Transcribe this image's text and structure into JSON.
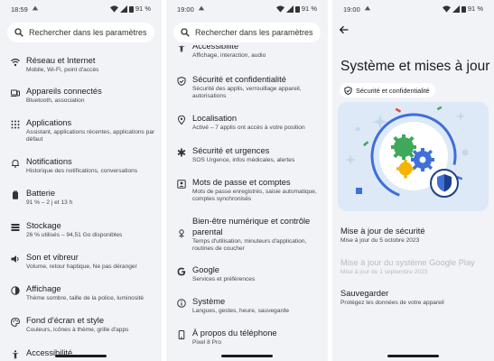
{
  "status_bars": [
    {
      "time": "18:59",
      "battery": "91 %"
    },
    {
      "time": "19:00",
      "battery": "91 %"
    },
    {
      "time": "19:00",
      "battery": "91 %"
    }
  ],
  "search": {
    "label": "Rechercher dans les paramètres"
  },
  "panel1": {
    "items": [
      {
        "icon": "wifi-icon",
        "title": "Réseau et Internet",
        "subtitle": "Mobile, Wi‑Fi, point d'accès"
      },
      {
        "icon": "devices-icon",
        "title": "Appareils connectés",
        "subtitle": "Bluetooth, association"
      },
      {
        "icon": "apps-grid-icon",
        "title": "Applications",
        "subtitle": "Assistant, applications récentes, applications par défaut"
      },
      {
        "icon": "bell-icon",
        "title": "Notifications",
        "subtitle": "Historique des notifications, conversations"
      },
      {
        "icon": "battery-icon",
        "title": "Batterie",
        "subtitle": "91 % – 2 j et 13 h"
      },
      {
        "icon": "storage-icon",
        "title": "Stockage",
        "subtitle": "26 % utilisés – 94,51 Go disponibles"
      },
      {
        "icon": "volume-icon",
        "title": "Son et vibreur",
        "subtitle": "Volume, retour haptique, Ne pas déranger"
      },
      {
        "icon": "brightness-icon",
        "title": "Affichage",
        "subtitle": "Thème sombre, taille de la police, luminosité"
      },
      {
        "icon": "palette-icon",
        "title": "Fond d'écran et style",
        "subtitle": "Couleurs, icônes à thème, grille d'apps"
      },
      {
        "icon": "accessibility-icon",
        "title": "Accessibilité",
        "subtitle": ""
      }
    ]
  },
  "panel2": {
    "items": [
      {
        "icon": "accessibility-icon",
        "title": "Accessibilité",
        "subtitle": "Affichage, interaction, audio"
      },
      {
        "icon": "shield-icon",
        "title": "Sécurité et confidentialité",
        "subtitle": "Sécurité des applis, verrouillage appareil, autorisations"
      },
      {
        "icon": "location-pin-icon",
        "title": "Localisation",
        "subtitle": "Activé – 7 applis ont accès à votre position"
      },
      {
        "icon": "emergency-icon",
        "title": "Sécurité et urgences",
        "subtitle": "SOS Urgence, infos médicales, alertes"
      },
      {
        "icon": "key-icon",
        "title": "Mots de passe et comptes",
        "subtitle": "Mots de passe enregistrés, saisie automatique, comptes synchronisés"
      },
      {
        "icon": "wellbeing-icon",
        "title": "Bien‑être numérique et contrôle parental",
        "subtitle": "Temps d'utilisation, minuteurs d'application, routines de coucher"
      },
      {
        "icon": "google-icon",
        "title": "Google",
        "subtitle": "Services et préférences"
      },
      {
        "icon": "info-icon",
        "title": "Système",
        "subtitle": "Langues, gestes, heure, sauvegarde"
      },
      {
        "icon": "phone-icon",
        "title": "À propos du téléphone",
        "subtitle": "Pixel 8 Pro"
      }
    ]
  },
  "panel3": {
    "title": "Système et mises à jour",
    "chip": "Sécurité et confidentialité",
    "items": [
      {
        "title": "Mise à jour de sécurité",
        "subtitle": "Mise à jour du 5 octobre 2023"
      },
      {
        "title": "Mise à jour du système Google Play",
        "subtitle": "Mise à jour du 1 septembre 2023"
      },
      {
        "title": "Sauvegarder",
        "subtitle": "Protégez les données de votre appareil"
      }
    ]
  },
  "colors": {
    "background": "#f1f3f6",
    "illustration_bg": "#dde9f7",
    "accent_blue": "#3f6fd8",
    "green": "#3fa85a",
    "yellow": "#f5b400"
  }
}
